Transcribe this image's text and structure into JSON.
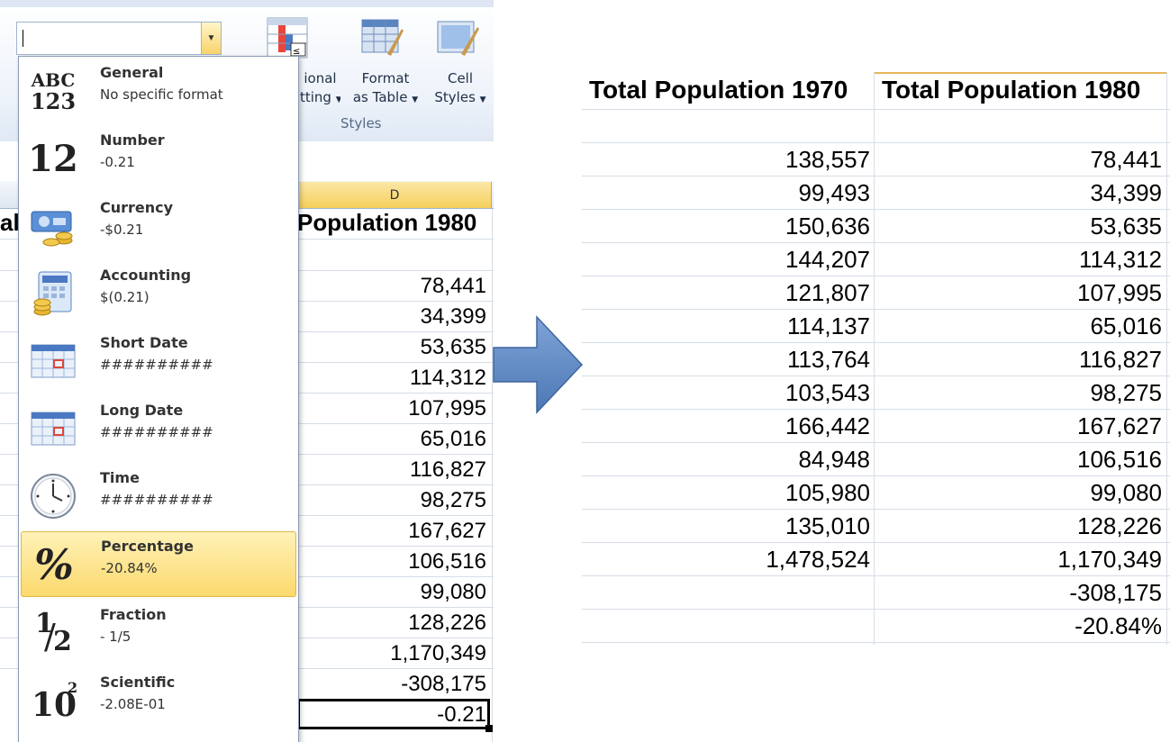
{
  "ribbon": {
    "number_format_value": "",
    "conditional_formatting": [
      "ional",
      "tting"
    ],
    "format_as_table": [
      "Format",
      "as Table"
    ],
    "cell_styles": [
      "Cell",
      "Styles"
    ],
    "group_label": "Styles"
  },
  "number_format_menu": {
    "items": [
      {
        "title": "General",
        "sample": "No specific format",
        "icon": "abc-123-icon"
      },
      {
        "title": "Number",
        "sample": "-0.21",
        "icon": "number-12-icon"
      },
      {
        "title": "Currency",
        "sample": "-$0.21",
        "icon": "currency-icon"
      },
      {
        "title": "Accounting",
        "sample": "$(0.21)",
        "icon": "accounting-icon"
      },
      {
        "title": "Short Date",
        "sample": "##########",
        "icon": "short-date-calendar-icon"
      },
      {
        "title": "Long Date",
        "sample": "##########",
        "icon": "long-date-calendar-icon"
      },
      {
        "title": "Time",
        "sample": "##########",
        "icon": "clock-icon"
      },
      {
        "title": "Percentage",
        "sample": "-20.84%",
        "icon": "percent-icon"
      },
      {
        "title": "Fraction",
        "sample": "- 1/5",
        "icon": "fraction-icon"
      },
      {
        "title": "Scientific",
        "sample": "-2.08E-01",
        "icon": "scientific-icon"
      }
    ],
    "selected": "Percentage",
    "glyphs": {
      "general_top": "ABC",
      "general_bottom": "123",
      "number": "12",
      "percent": "%",
      "fraction_num": "1",
      "fraction_den": "2",
      "sci_base": "10",
      "sci_exp": "2"
    }
  },
  "left_sheet": {
    "column_letter": "D",
    "partial_header": "al",
    "column_header": "Population 1980",
    "values": [
      "78,441",
      "34,399",
      "53,635",
      "114,312",
      "107,995",
      "65,016",
      "116,827",
      "98,275",
      "167,627",
      "106,516",
      "99,080",
      "128,226",
      "1,170,349",
      "-308,175",
      "-0.21"
    ]
  },
  "result_table": {
    "headers": [
      "Total Population 1970",
      "Total Population 1980"
    ],
    "col1970": [
      "138,557",
      "99,493",
      "150,636",
      "144,207",
      "121,807",
      "114,137",
      "113,764",
      "103,543",
      "166,442",
      "84,948",
      "105,980",
      "135,010",
      "1,478,524",
      "",
      ""
    ],
    "col1980": [
      "78,441",
      "34,399",
      "53,635",
      "114,312",
      "107,995",
      "65,016",
      "116,827",
      "98,275",
      "167,627",
      "106,516",
      "99,080",
      "128,226",
      "1,170,349",
      "-308,175",
      "-20.84%"
    ]
  },
  "colors": {
    "selection": "#fbd96c",
    "arrow": "#5b85c0",
    "column_highlight": "#f6cf5b"
  }
}
